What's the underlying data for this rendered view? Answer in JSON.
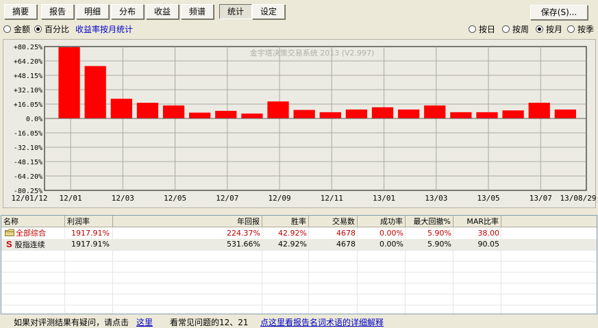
{
  "toolbar": {
    "tabs": [
      "摘要",
      "报告",
      "明细",
      "分布",
      "收益",
      "频谱",
      "统计",
      "设定"
    ],
    "active_tab": "统计",
    "save_label": "保存(S)..."
  },
  "mode_radios": {
    "amount": "金额",
    "percent": "百分比",
    "selected": "百分比"
  },
  "monthly_link": "收益率按月统计",
  "period_radios": {
    "day": "按日",
    "week": "按周",
    "month": "按月",
    "season": "按季",
    "selected": "按月"
  },
  "chart_data": {
    "type": "bar",
    "watermark": "金宇塔决策交易系统 2013 (V2.997)",
    "y_ticks": [
      "+80.25%",
      "+64.20%",
      "+48.15%",
      "+32.10%",
      "+16.05%",
      "0.0%",
      "-16.05%",
      "-32.10%",
      "-48.15%",
      "-64.20%",
      "-80.25%"
    ],
    "ylim": [
      -80.25,
      80.25
    ],
    "x_ticks": [
      "12/01/12",
      "12/01",
      "12/03",
      "12/05",
      "12/07",
      "12/09",
      "12/11",
      "13/01",
      "13/03",
      "13/05",
      "13/07",
      "13/08/29"
    ],
    "categories": [
      "2012-01",
      "2012-02",
      "2012-03",
      "2012-04",
      "2012-05",
      "2012-06",
      "2012-07",
      "2012-08",
      "2012-09",
      "2012-10",
      "2012-11",
      "2012-12",
      "2013-01",
      "2013-02",
      "2013-03",
      "2013-04",
      "2013-05",
      "2013-06",
      "2013-07",
      "2013-08"
    ],
    "values": [
      79.5,
      58.5,
      22.0,
      17.5,
      14.5,
      6.5,
      8.5,
      5.5,
      19.0,
      9.5,
      7.0,
      10.0,
      12.5,
      10.0,
      14.5,
      7.0,
      7.0,
      9.0,
      17.5,
      10.0
    ],
    "bar_color": "#ff0000",
    "grid": true
  },
  "table": {
    "columns": [
      "名称",
      "利润率",
      "年回报",
      "胜率",
      "交易数",
      "成功率",
      "最大回撤%",
      "MAR比率"
    ],
    "rows": [
      {
        "icon": "folder-icon",
        "name": "全部综合",
        "profit": "1917.91%",
        "annual": "224.37%",
        "win": "42.92%",
        "trades": "4678",
        "success": "0.00%",
        "drawdown": "5.90%",
        "mar": "38.00"
      },
      {
        "icon": "s-strategy-icon",
        "name": "股指连续",
        "profit": "1917.91%",
        "annual": "531.66%",
        "win": "42.92%",
        "trades": "4678",
        "success": "0.00%",
        "drawdown": "5.90%",
        "mar": "90.05"
      }
    ]
  },
  "footer": {
    "question_text": "如果对评测结果有疑问，请点击",
    "here_link": "这里",
    "faq_text": "看常见问题的12、21",
    "glossary_link": "点这里看报告名词术语的详细解释"
  },
  "colors": {
    "row_highlight_text": "#c00000",
    "link": "#0000c8",
    "icon_red": "#c00000"
  }
}
